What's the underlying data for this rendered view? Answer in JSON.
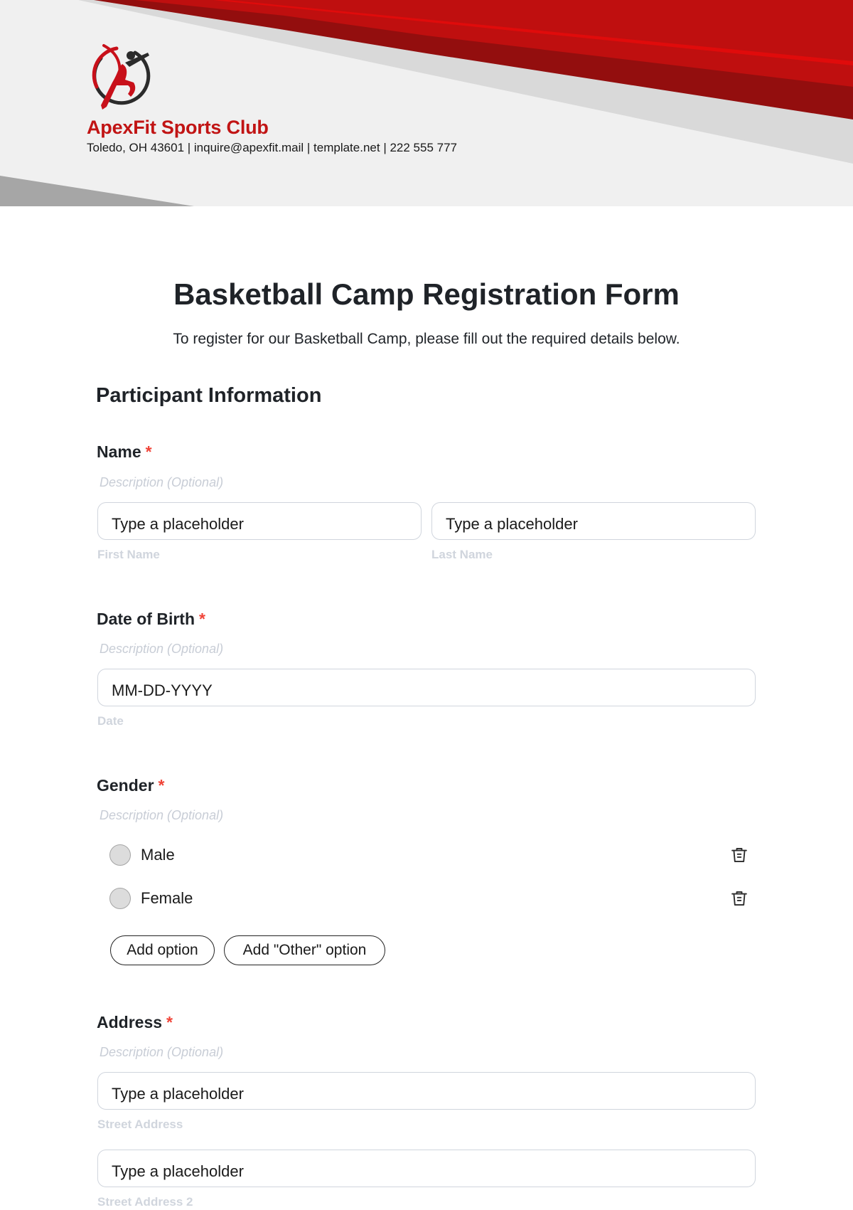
{
  "header": {
    "club_name": "ApexFit Sports Club",
    "contact_line": "Toledo, OH 43601 | inquire@apexfit.mail | template.net | 222 555 777",
    "logo_icon": "athlete-logo-icon",
    "colors": {
      "brand_red": "#c11414",
      "dark_red": "#930e0e",
      "bright_red": "#e00b0b",
      "band_gray": "#d9d9d9",
      "wedge_gray": "#a6a6a6",
      "header_bg": "#f0f0f0"
    }
  },
  "form": {
    "title": "Basketball Camp Registration Form",
    "subtitle": "To register for our Basketball Camp, please fill out the required details below.",
    "section_title": "Participant Information",
    "required_mark": "*",
    "fields": {
      "name": {
        "label": "Name",
        "description": "Description (Optional)",
        "first": {
          "placeholder": "Type a placeholder",
          "sublabel": "First Name"
        },
        "last": {
          "placeholder": "Type a placeholder",
          "sublabel": "Last Name"
        }
      },
      "dob": {
        "label": "Date of Birth",
        "description": "Description (Optional)",
        "placeholder": "MM-DD-YYYY",
        "sublabel": "Date"
      },
      "gender": {
        "label": "Gender",
        "description": "Description (Optional)",
        "options": [
          {
            "label": "Male",
            "selected": false
          },
          {
            "label": "Female",
            "selected": false
          }
        ],
        "add_option_label": "Add option",
        "add_other_label": "Add \"Other\" option",
        "delete_icon": "trash-icon"
      },
      "address": {
        "label": "Address",
        "description": "Description (Optional)",
        "street": {
          "placeholder": "Type a placeholder",
          "sublabel": "Street Address"
        },
        "street2": {
          "placeholder": "Type a placeholder",
          "sublabel": "Street Address 2"
        }
      }
    },
    "colors": {
      "required": "#f04438",
      "muted": "#c8cdd6",
      "input_border": "#d0d5dd",
      "text": "#1f2328"
    }
  }
}
